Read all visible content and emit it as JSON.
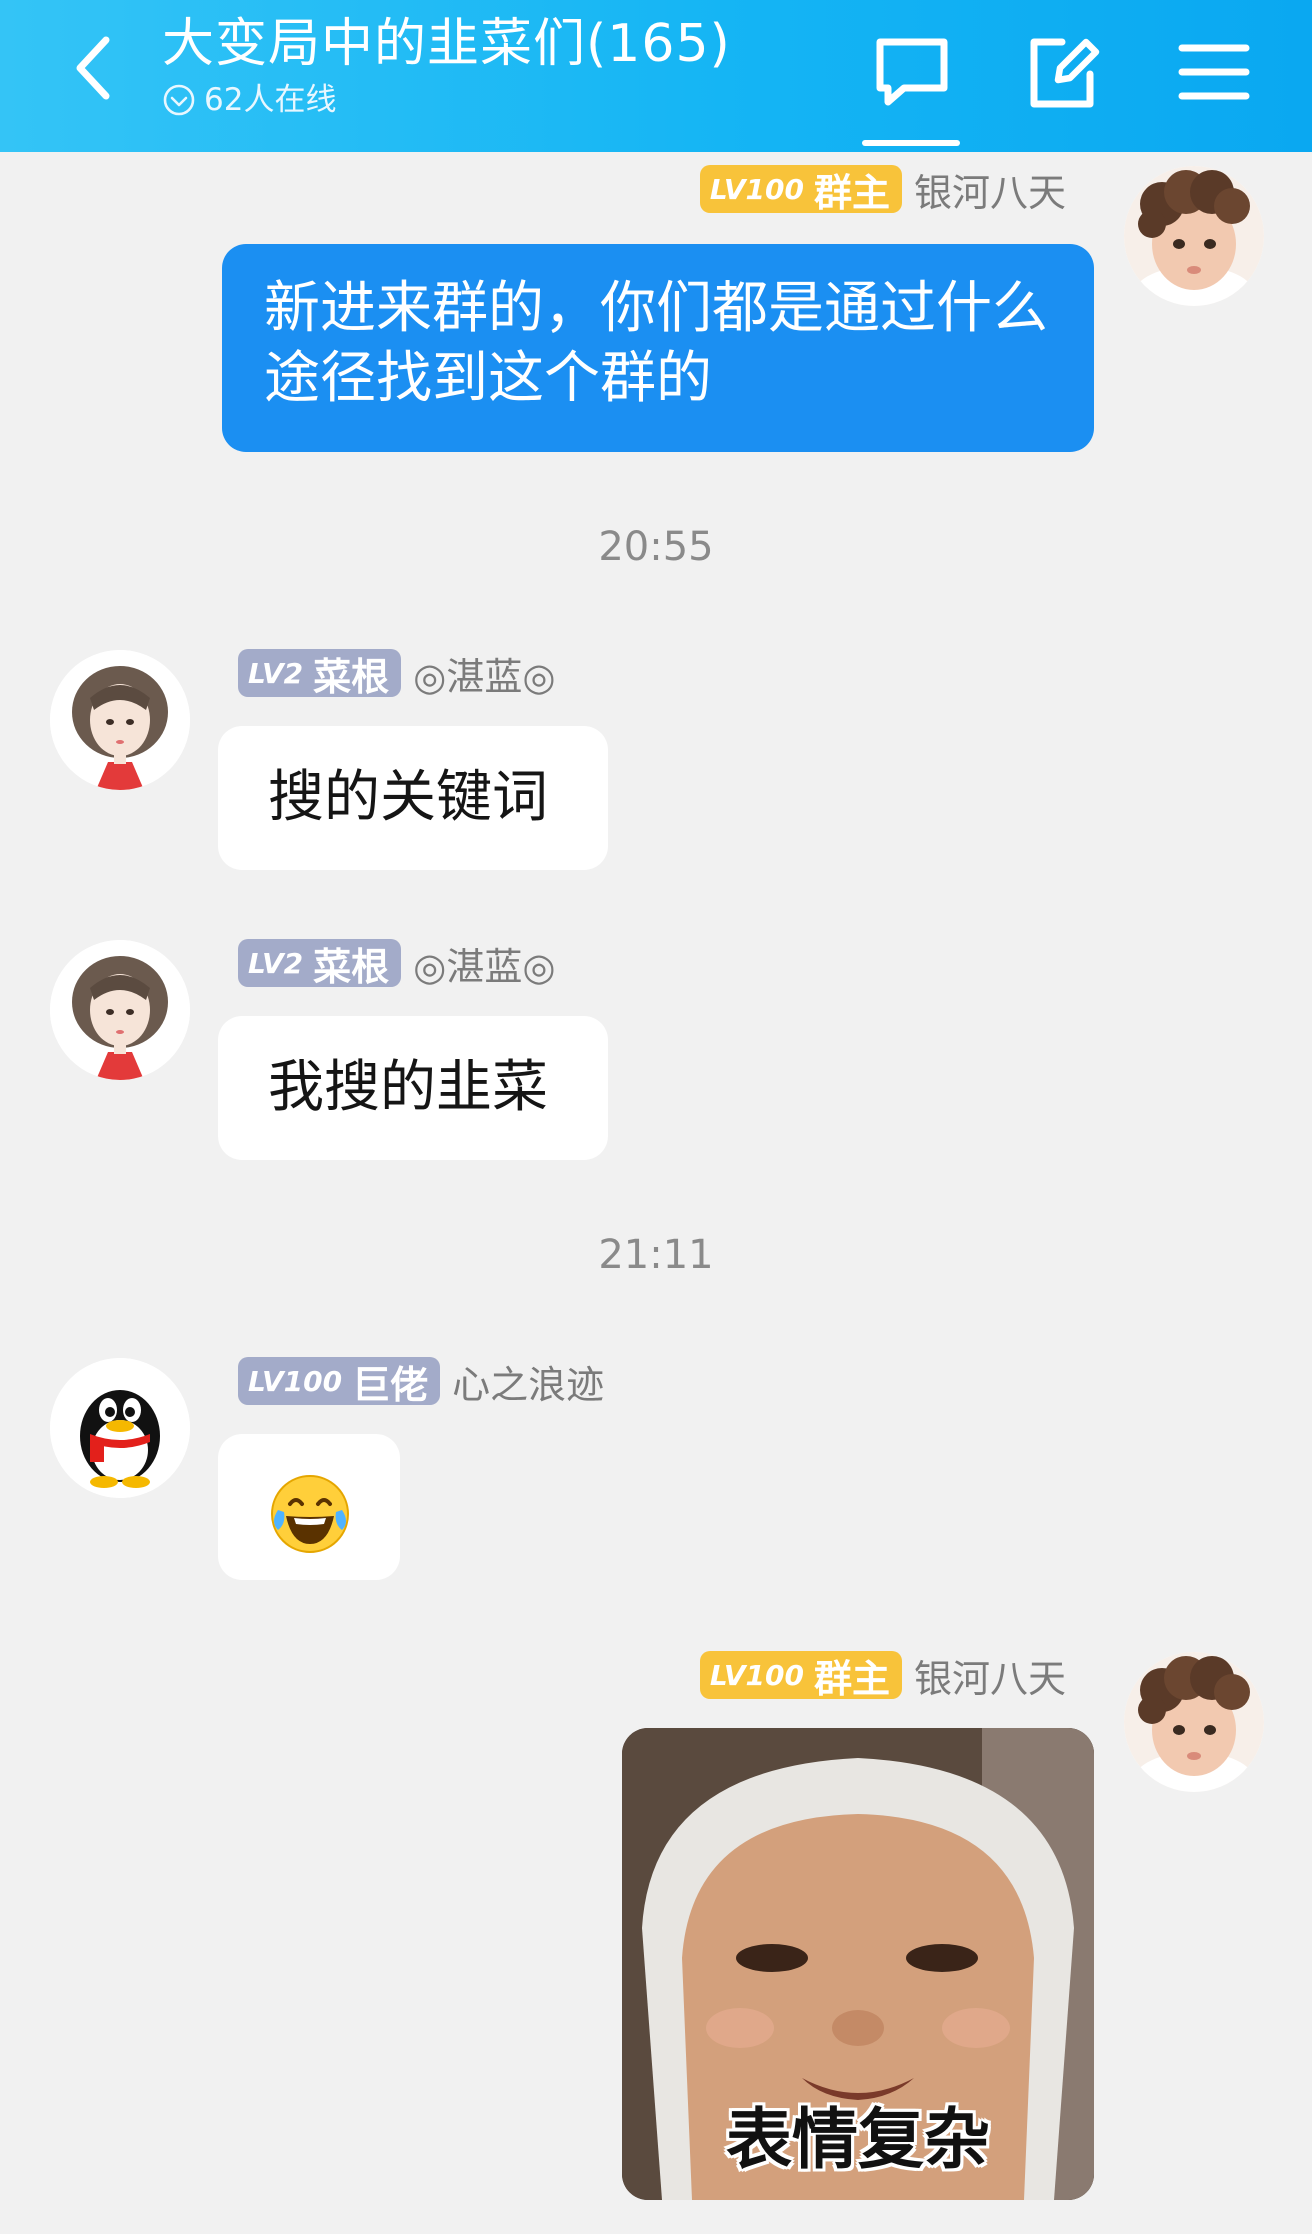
{
  "header": {
    "title": "大变局中的韭菜们(165)",
    "online_status": "62人在线",
    "icons": [
      "back-icon",
      "chat-bubble-icon",
      "edit-icon",
      "menu-icon"
    ]
  },
  "messages": [
    {
      "direction": "outgoing",
      "level": "LV100",
      "role": "群主",
      "sender": "银河八天",
      "avatar": "baby-avatar",
      "text": "新进来群的，你们都是通过什么途径找到这个群的"
    },
    {
      "timestamp": "20:55"
    },
    {
      "direction": "incoming",
      "level": "LV2",
      "role": "菜根",
      "sender": "◎湛蓝◎",
      "avatar": "girl-avatar",
      "text": "搜的关键词"
    },
    {
      "direction": "incoming",
      "level": "LV2",
      "role": "菜根",
      "sender": "◎湛蓝◎",
      "avatar": "girl-avatar",
      "text": "我搜的韭菜"
    },
    {
      "timestamp": "21:11"
    },
    {
      "direction": "incoming",
      "level": "LV100",
      "role": "巨佬",
      "sender": "心之浪迹",
      "avatar": "qq-penguin-avatar",
      "text": "😂"
    },
    {
      "direction": "outgoing",
      "level": "LV100",
      "role": "群主",
      "sender": "银河八天",
      "avatar": "baby-avatar",
      "sticker_caption": "表情复杂"
    }
  ],
  "colors": {
    "header": "#15b5f4",
    "outgoing_bubble": "#1b8ff2",
    "owner_badge": "#f8c33a",
    "member_badge": "#a3abc9",
    "background": "#f1f1f1"
  }
}
